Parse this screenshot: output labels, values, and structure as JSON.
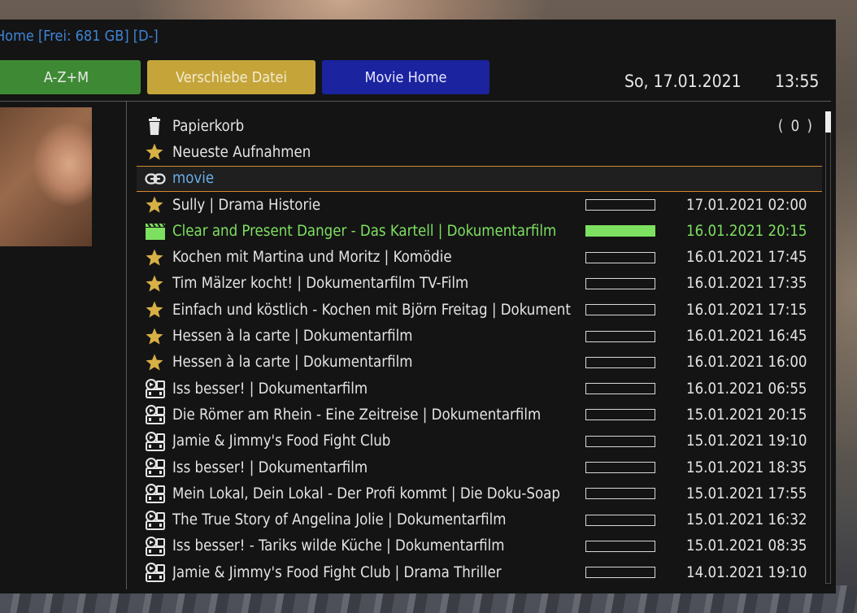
{
  "header": {
    "title": "Home [Frei: 681 GB] [D-]",
    "date": "So, 17.01.2021",
    "time": "13:55"
  },
  "buttons": {
    "red_green": "A-Z+M",
    "yellow": "Verschiebe Datei",
    "blue": "Movie Home"
  },
  "colors": {
    "title": "#3e84d6",
    "green_button": "#3e8a34",
    "yellow_button": "#c5a53a",
    "blue_button": "#1b239f",
    "selection_text": "#7ee060",
    "highlight_border": "#d28a2a"
  },
  "directories": [
    {
      "icon": "trash-icon",
      "label": "Papierkorb",
      "count": "( 0 )"
    },
    {
      "icon": "star-icon",
      "label": "Neueste Aufnahmen",
      "count": ""
    },
    {
      "icon": "link-icon",
      "label": "movie",
      "count": ""
    }
  ],
  "recordings": [
    {
      "icon": "star-icon",
      "title": "Sully | Drama Historie",
      "date": "17.01.2021 02:00",
      "progress": 0
    },
    {
      "icon": "clapperboard-icon",
      "title": "Clear and Present Danger - Das Kartell | Dokumentarfilm",
      "date": "16.01.2021 20:15",
      "progress": 100
    },
    {
      "icon": "star-icon",
      "title": "Kochen mit Martina und Moritz | Komödie",
      "date": "16.01.2021 17:45",
      "progress": 0
    },
    {
      "icon": "star-icon",
      "title": "Tim Mälzer kocht! | Dokumentarfilm TV-Film",
      "date": "16.01.2021 17:35",
      "progress": 0
    },
    {
      "icon": "star-icon",
      "title": "Einfach und köstlich - Kochen mit Björn Freitag | Dokument",
      "date": "16.01.2021 17:15",
      "progress": 0
    },
    {
      "icon": "star-icon",
      "title": "Hessen à la carte | Dokumentarfilm",
      "date": "16.01.2021 16:45",
      "progress": 0
    },
    {
      "icon": "star-icon",
      "title": "Hessen à la carte | Dokumentarfilm",
      "date": "16.01.2021 16:00",
      "progress": 0
    },
    {
      "icon": "film-reel-icon",
      "title": "Iss besser! | Dokumentarfilm",
      "date": "16.01.2021 06:55",
      "progress": 0
    },
    {
      "icon": "film-reel-icon",
      "title": "Die Römer am Rhein - Eine Zeitreise | Dokumentarfilm",
      "date": "15.01.2021 20:15",
      "progress": 0
    },
    {
      "icon": "film-reel-icon",
      "title": "Jamie & Jimmy's Food Fight Club",
      "date": "15.01.2021 19:10",
      "progress": 0
    },
    {
      "icon": "film-reel-icon",
      "title": "Iss besser! | Dokumentarfilm",
      "date": "15.01.2021 18:35",
      "progress": 0
    },
    {
      "icon": "film-reel-icon",
      "title": "Mein Lokal, Dein Lokal - Der Profi kommt | Die Doku-Soap",
      "date": "15.01.2021 17:55",
      "progress": 0
    },
    {
      "icon": "film-reel-icon",
      "title": "The True Story of Angelina Jolie | Dokumentarfilm",
      "date": "15.01.2021 16:32",
      "progress": 0
    },
    {
      "icon": "film-reel-icon",
      "title": "Iss besser! - Tariks wilde Küche | Dokumentarfilm",
      "date": "15.01.2021 08:35",
      "progress": 0
    },
    {
      "icon": "film-reel-icon",
      "title": "Jamie & Jimmy's Food Fight Club | Drama Thriller",
      "date": "14.01.2021 19:10",
      "progress": 0
    }
  ],
  "selected_index": 1,
  "highlighted_directory": 2
}
